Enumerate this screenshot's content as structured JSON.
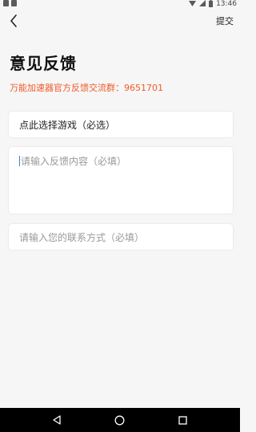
{
  "status_bar": {
    "time": "13:46"
  },
  "header": {
    "back_icon": "chevron-left-icon",
    "submit_label": "提交"
  },
  "page": {
    "title": "意见反馈",
    "group_info": "万能加速器官方反馈交流群：9651701"
  },
  "form": {
    "game_select_label": "点此选择游戏（必选）",
    "feedback_placeholder": "请输入反馈内容（必填）",
    "contact_placeholder": "请输入您的联系方式（必填）"
  },
  "colors": {
    "accent": "#f05a2a",
    "background": "#f6f6f6",
    "nav_bar": "#000000"
  },
  "nav": {
    "icons": [
      "back-triangle-icon",
      "home-circle-icon",
      "recents-square-icon"
    ]
  }
}
